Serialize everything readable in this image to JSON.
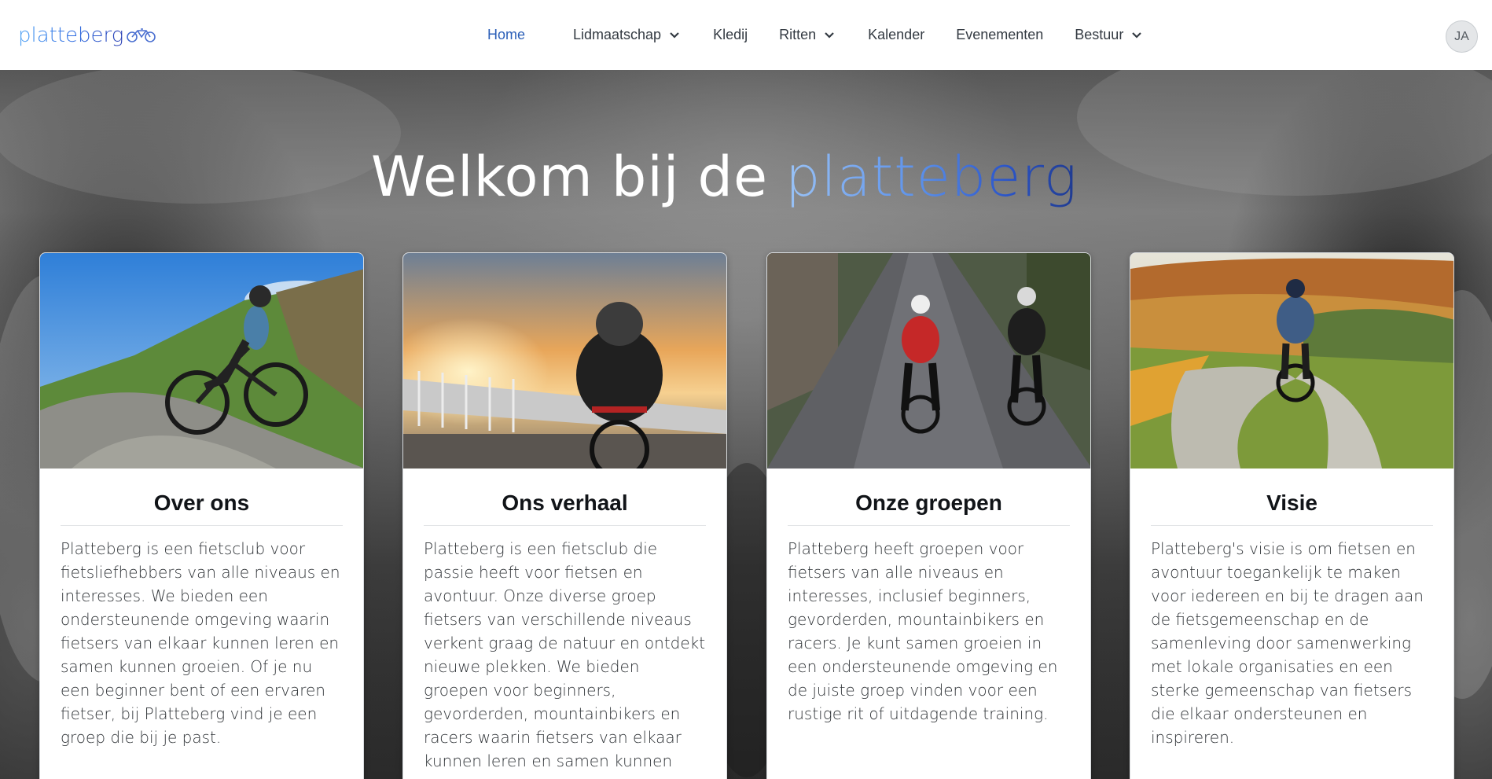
{
  "header": {
    "logo_text": "platteberg",
    "nav": [
      {
        "label": "Home",
        "active": true,
        "dropdown": false
      },
      {
        "label": "Lidmaatschap",
        "active": false,
        "dropdown": true
      },
      {
        "label": "Kledij",
        "active": false,
        "dropdown": false
      },
      {
        "label": "Ritten",
        "active": false,
        "dropdown": true
      },
      {
        "label": "Kalender",
        "active": false,
        "dropdown": false
      },
      {
        "label": "Evenementen",
        "active": false,
        "dropdown": false
      },
      {
        "label": "Bestuur",
        "active": false,
        "dropdown": true
      }
    ],
    "avatar_initials": "JA"
  },
  "hero": {
    "title_prefix": "Welkom bij de",
    "title_brand": "platteberg"
  },
  "cards": [
    {
      "title": "Over ons",
      "image": "mountain biker on gravel hillside path",
      "text": "Platteberg is een fietsclub voor fietsliefhebbers van alle niveaus en interesses. We bieden een ondersteunende omgeving waarin fietsers van elkaar kunnen leren en samen kunnen groeien. Of je nu een beginner bent of een ervaren fietser, bij Platteberg vind je een groep die bij je past."
    },
    {
      "title": "Ons verhaal",
      "image": "road cyclist on bridge at sunset",
      "text": "Platteberg is een fietsclub die passie heeft voor fietsen en avontuur. Onze diverse groep fietsers van verschillende niveaus verkent graag de natuur en ontdekt nieuwe plekken. We bieden groepen voor beginners, gevorderden, mountainbikers en racers waarin fietsers van elkaar kunnen leren en samen kunnen"
    },
    {
      "title": "Onze groepen",
      "image": "two road cyclists on wet country road",
      "text": "Platteberg heeft groepen voor fietsers van alle niveaus en interesses, inclusief beginners, gevorderden, mountainbikers en racers. Je kunt samen groeien in een ondersteunende omgeving en de juiste groep vinden voor een rustige rit of uitdagende training."
    },
    {
      "title": "Visie",
      "image": "cyclist on winding path through autumn landscape",
      "text": "Platteberg's visie is om fietsen en avontuur toegankelijk te maken voor iedereen en bij te dragen aan de fietsgemeenschap en de samenleving door samenwerking met lokale organisaties en een sterke gemeenschap van fietsers die elkaar ondersteunen en inspireren."
    }
  ],
  "colors": {
    "nav_active": "#2b5fb8",
    "brand_light": "#5d92ea",
    "brand_dark": "#1f3a8f"
  }
}
